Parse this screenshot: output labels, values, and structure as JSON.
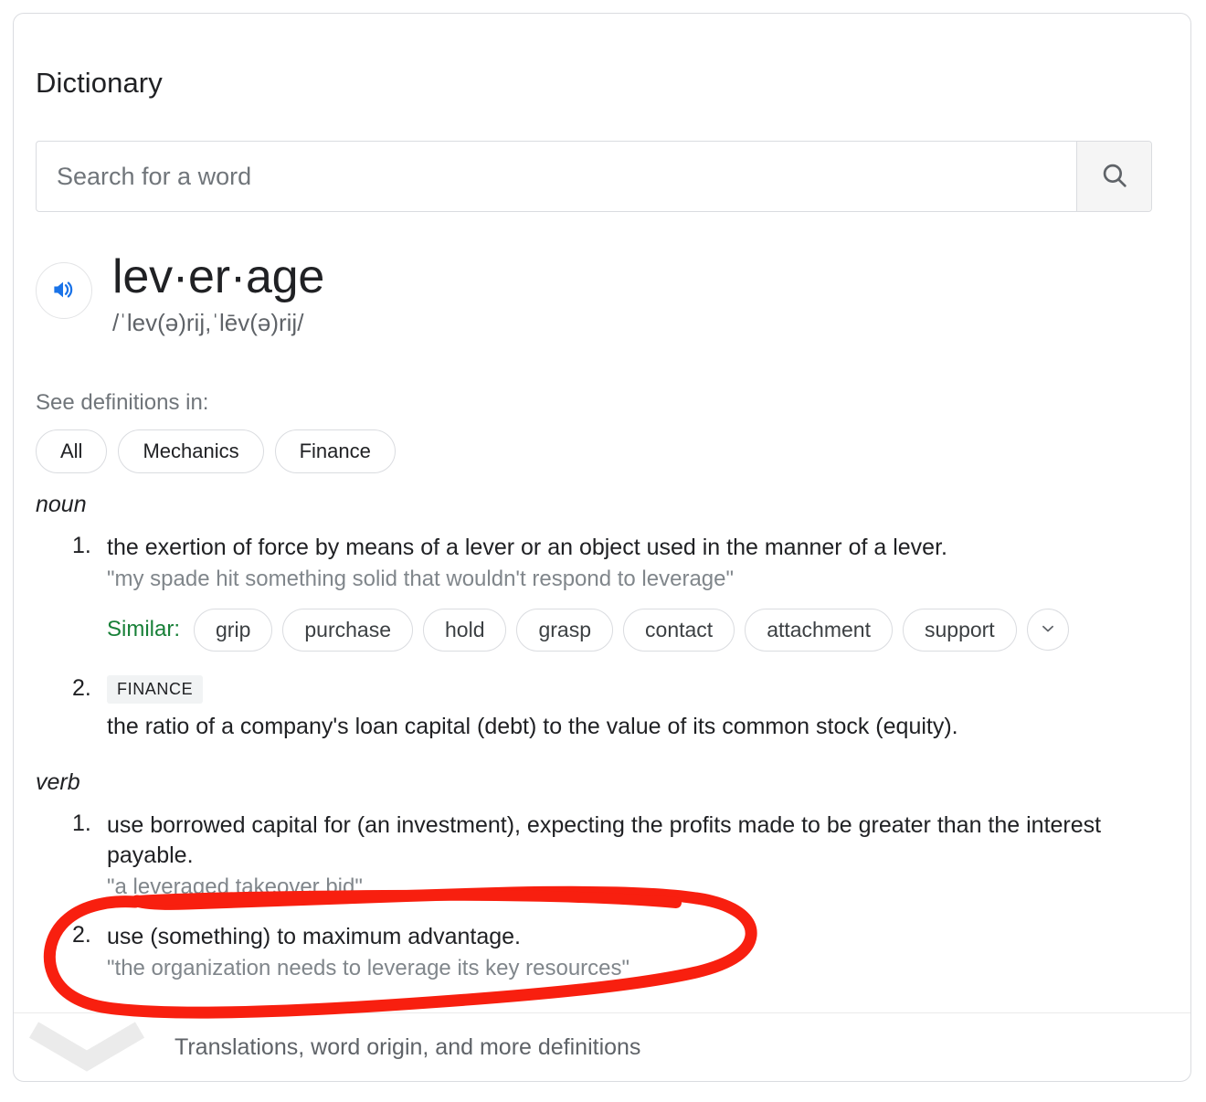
{
  "card": {
    "title": "Dictionary"
  },
  "search": {
    "placeholder": "Search for a word",
    "value": "",
    "button_icon": "search-icon"
  },
  "entry": {
    "headword": "lev·er·age",
    "phonetic": "/ˈlev(ə)rij,ˈlēv(ə)rij/",
    "audio_icon": "speaker-icon",
    "see_definitions_label": "See definitions in:",
    "filters": [
      {
        "label": "All",
        "selected": false
      },
      {
        "label": "Mechanics",
        "selected": false
      },
      {
        "label": "Finance",
        "selected": false
      }
    ]
  },
  "senses": [
    {
      "part_of_speech": "noun",
      "definitions": [
        {
          "number": "1.",
          "field": null,
          "text": "the exertion of force by means of a lever or an object used in the manner of a lever.",
          "example": "\"my spade hit something solid that wouldn't respond to leverage\"",
          "similar": {
            "label": "Similar:",
            "words": [
              "grip",
              "purchase",
              "hold",
              "grasp",
              "contact",
              "attachment",
              "support"
            ],
            "more_icon": "chevron-down-icon"
          }
        },
        {
          "number": "2.",
          "field": "FINANCE",
          "text": "the ratio of a company's loan capital (debt) to the value of its common stock (equity).",
          "example": null,
          "similar": null
        }
      ]
    },
    {
      "part_of_speech": "verb",
      "definitions": [
        {
          "number": "1.",
          "field": null,
          "text": "use borrowed capital for (an investment), expecting the profits made to be greater than the interest payable.",
          "example": "\"a leveraged takeover bid\"",
          "similar": null
        },
        {
          "number": "2.",
          "field": null,
          "text": "use (something) to maximum advantage.",
          "example": "\"the organization needs to leverage its key resources\"",
          "similar": null
        }
      ]
    }
  ],
  "footer": {
    "expand_label": "Translations, word origin, and more definitions",
    "chevron_icon": "chevron-down-icon"
  },
  "annotation": {
    "type": "hand-drawn-circle",
    "color": "#f81f0f",
    "target": "verb definition 2"
  },
  "colors": {
    "accent_blue": "#1a73e8",
    "similar_green": "#188038",
    "border_gray": "#dadce0",
    "text_primary": "#202124",
    "text_secondary": "#5f6368",
    "text_muted": "#80868b",
    "badge_bg": "#f1f3f4",
    "annotation_red": "#f81f0f"
  }
}
